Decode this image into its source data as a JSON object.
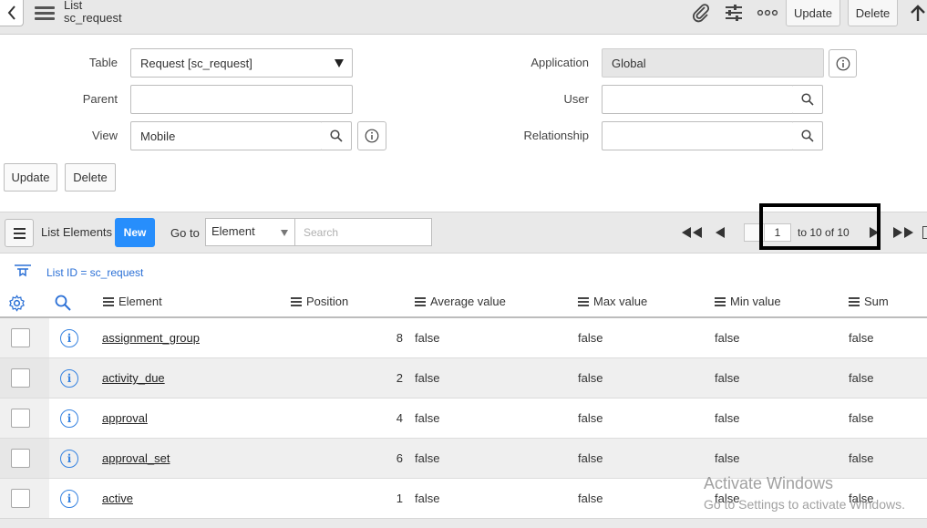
{
  "header": {
    "title_line1": "List",
    "title_line2": "sc_request",
    "update_label": "Update",
    "delete_label": "Delete",
    "icons": [
      "back-icon",
      "menu-icon",
      "attachment-icon",
      "settings-sliders-icon",
      "more-icon",
      "scroll-up-icon"
    ]
  },
  "form": {
    "table_label": "Table",
    "table_value": "Request [sc_request]",
    "parent_label": "Parent",
    "parent_value": "",
    "view_label": "View",
    "view_value": "Mobile",
    "application_label": "Application",
    "application_value": "Global",
    "user_label": "User",
    "user_value": "",
    "relationship_label": "Relationship",
    "relationship_value": "",
    "update_label": "Update",
    "delete_label": "Delete"
  },
  "list_toolbar": {
    "title": "List Elements",
    "new_label": "New",
    "goto_label": "Go to",
    "goto_field": "Element",
    "search_placeholder": "Search",
    "page_value": "1",
    "range_text": "to 10 of 10"
  },
  "filter": {
    "text": "List ID = sc_request"
  },
  "columns": [
    "Element",
    "Position",
    "Average value",
    "Max value",
    "Min value",
    "Sum"
  ],
  "rows": [
    {
      "element": "assignment_group",
      "position": "8",
      "average": "false",
      "max": "false",
      "min": "false",
      "sum": "false"
    },
    {
      "element": "activity_due",
      "position": "2",
      "average": "false",
      "max": "false",
      "min": "false",
      "sum": "false"
    },
    {
      "element": "approval",
      "position": "4",
      "average": "false",
      "max": "false",
      "min": "false",
      "sum": "false"
    },
    {
      "element": "approval_set",
      "position": "6",
      "average": "false",
      "max": "false",
      "min": "false",
      "sum": "false"
    },
    {
      "element": "active",
      "position": "1",
      "average": "false",
      "max": "false",
      "min": "false",
      "sum": "false"
    }
  ],
  "watermark": {
    "line1": "Activate Windows",
    "line2": "Go to Settings to activate Windows."
  },
  "colors": {
    "accent": "#278efc",
    "link_blue": "#2b70d6",
    "highlight_box": "#000000"
  }
}
